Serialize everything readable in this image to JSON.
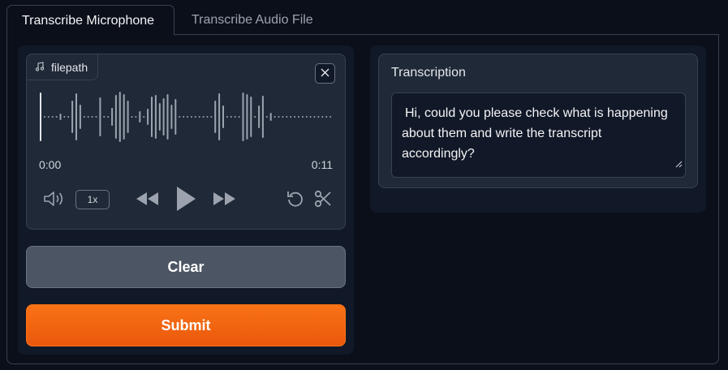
{
  "tabs": [
    {
      "label": "Transcribe Microphone",
      "active": true
    },
    {
      "label": "Transcribe Audio File",
      "active": false
    }
  ],
  "audio": {
    "label": "filepath",
    "current_time": "0:00",
    "duration": "0:11",
    "playback_speed": "1x",
    "icons": [
      "music-note-icon",
      "close-icon",
      "volume-icon",
      "rewind-icon",
      "play-icon",
      "fast-forward-icon",
      "undo-icon",
      "scissors-icon"
    ]
  },
  "buttons": {
    "clear": "Clear",
    "submit": "Submit"
  },
  "transcription": {
    "label": "Transcription",
    "text": "Hi, could you please check what is happening about them and write the transcript accordingly?"
  },
  "colors": {
    "background": "#0b0f19",
    "panel": "#111827",
    "block": "#1f2937",
    "border": "#374151",
    "clear_button": "#4b5563",
    "submit_button": "#f97316"
  }
}
